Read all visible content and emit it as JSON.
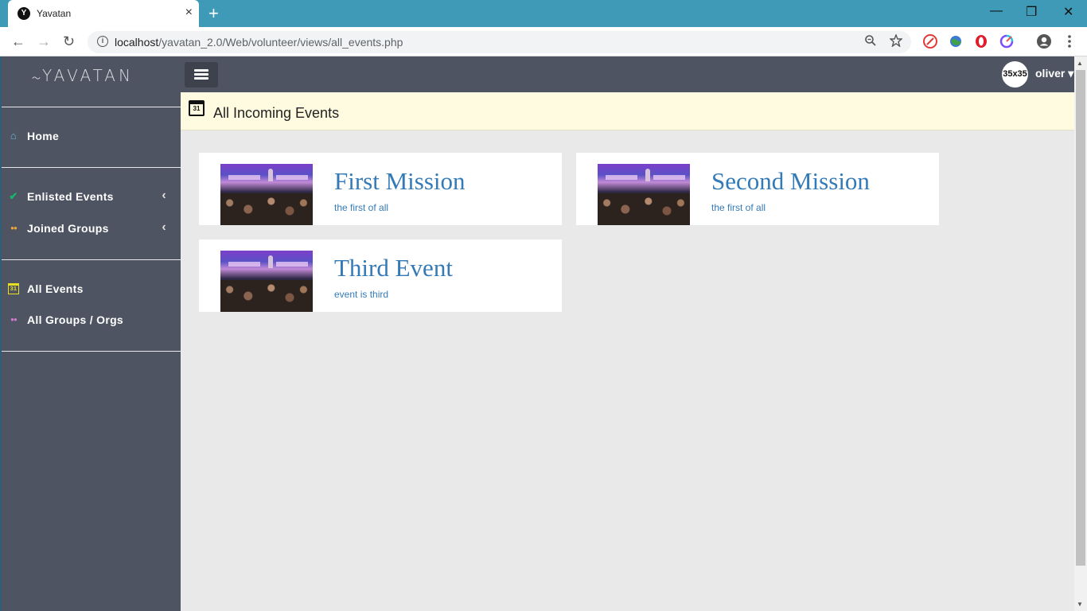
{
  "browser": {
    "tab_title": "Yavatan",
    "tab_favicon": "Y",
    "tab_close": "×",
    "new_tab": "+",
    "url_host": "localhost",
    "url_path": "/yavatan_2.0/Web/volunteer/views/all_events.php",
    "window_controls": {
      "minimize": "—",
      "restore": "❐",
      "close": "✕"
    },
    "nav": {
      "back": "←",
      "forward": "→",
      "reload": "↻"
    }
  },
  "app": {
    "logo": "YAVATAN",
    "logo_mark": "〜",
    "user": {
      "avatar_text": "35x35",
      "name": "oliver ▾"
    }
  },
  "sidebar": {
    "items": [
      {
        "label": "Home",
        "icon": "home-icon",
        "icon_glyph": "⌂",
        "icon_color": "#6fb7d6",
        "caret": ""
      },
      {
        "label": "Enlisted Events",
        "icon": "check-icon",
        "icon_glyph": "✔",
        "icon_color": "#19b56a",
        "caret": "‹"
      },
      {
        "label": "Joined Groups",
        "icon": "group-icon",
        "icon_glyph": "●●",
        "icon_color": "#f0a33a",
        "caret": "‹"
      },
      {
        "label": "All Events",
        "icon": "calendar-icon",
        "icon_glyph": "31",
        "icon_color": "#e8e020",
        "caret": ""
      },
      {
        "label": "All Groups / Orgs",
        "icon": "group-icon",
        "icon_glyph": "●●",
        "icon_color": "#d07ad0",
        "caret": ""
      }
    ]
  },
  "page": {
    "header_icon_text": "31",
    "title": "All Incoming Events"
  },
  "events": [
    {
      "title": "First Mission",
      "subtitle": "the first of all"
    },
    {
      "title": "Second Mission",
      "subtitle": "the first of all"
    },
    {
      "title": "Third Event",
      "subtitle": "event is third"
    }
  ],
  "colors": {
    "titlebar": "#3e9ab7",
    "sidebar": "#4e5461",
    "link": "#337ab7",
    "header_bg": "#fffbe0",
    "content_bg": "#e9e9e9"
  }
}
